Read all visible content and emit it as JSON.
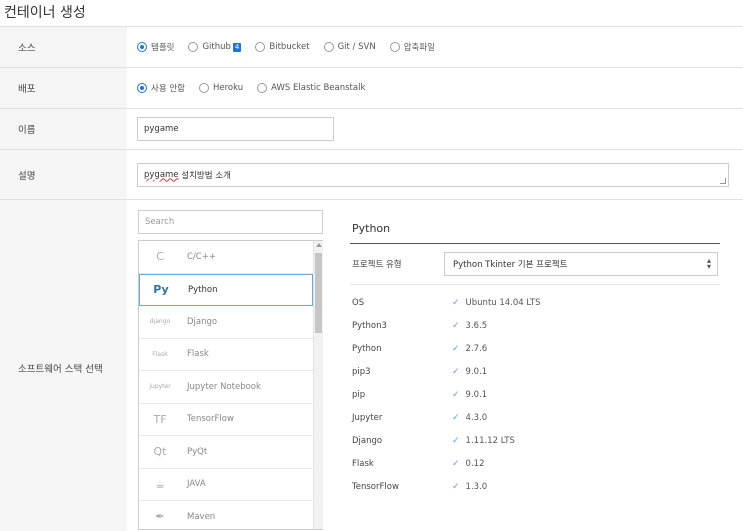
{
  "page_title": "컨테이너 생성",
  "rows": {
    "source": {
      "label": "소스",
      "options": [
        {
          "label": "템플릿",
          "checked": true
        },
        {
          "label": "Github",
          "checked": false,
          "badge": "4"
        },
        {
          "label": "Bitbucket",
          "checked": false
        },
        {
          "label": "Git / SVN",
          "checked": false
        },
        {
          "label": "압축파일",
          "checked": false
        }
      ]
    },
    "deploy": {
      "label": "배포",
      "options": [
        {
          "label": "사용 안함",
          "checked": true
        },
        {
          "label": "Heroku",
          "checked": false
        },
        {
          "label": "AWS Elastic Beanstalk",
          "checked": false
        }
      ]
    },
    "name": {
      "label": "이름",
      "value": "pygame"
    },
    "description": {
      "label": "설명",
      "value_underlined": "pygame",
      "value_rest": " 설치방법 소개"
    },
    "stack": {
      "label": "소프트웨어 스택 선택"
    }
  },
  "stack": {
    "search_placeholder": "Search",
    "items": [
      {
        "label": "C/C++",
        "icon": "c-icon",
        "glyph": "C"
      },
      {
        "label": "Python",
        "icon": "python-icon",
        "glyph": "Py",
        "selected": true
      },
      {
        "label": "Django",
        "icon": "django-icon",
        "glyph": "django"
      },
      {
        "label": "Flask",
        "icon": "flask-icon",
        "glyph": "Flask"
      },
      {
        "label": "Jupyter Notebook",
        "icon": "jupyter-icon",
        "glyph": "jupyter"
      },
      {
        "label": "TensorFlow",
        "icon": "tensorflow-icon",
        "glyph": "TF"
      },
      {
        "label": "PyQt",
        "icon": "qt-icon",
        "glyph": "Qt"
      },
      {
        "label": "JAVA",
        "icon": "java-icon",
        "glyph": "☕"
      },
      {
        "label": "Maven",
        "icon": "maven-icon",
        "glyph": "✒"
      }
    ]
  },
  "detail": {
    "title": "Python",
    "project_type_label": "프로젝트 유형",
    "project_type_value": "Python Tkinter 기본 프로젝트",
    "versions": [
      {
        "name": "OS",
        "value": "Ubuntu 14.04 LTS"
      },
      {
        "name": "Python3",
        "value": "3.6.5"
      },
      {
        "name": "Python",
        "value": "2.7.6"
      },
      {
        "name": "pip3",
        "value": "9.0.1"
      },
      {
        "name": "pip",
        "value": "9.0.1"
      },
      {
        "name": "Jupyter",
        "value": "4.3.0"
      },
      {
        "name": "Django",
        "value": "1.11.12 LTS"
      },
      {
        "name": "Flask",
        "value": "0.12"
      },
      {
        "name": "TensorFlow",
        "value": "1.3.0"
      }
    ]
  },
  "colors": {
    "accent": "#1e73d6",
    "check": "#5b9ee6"
  }
}
